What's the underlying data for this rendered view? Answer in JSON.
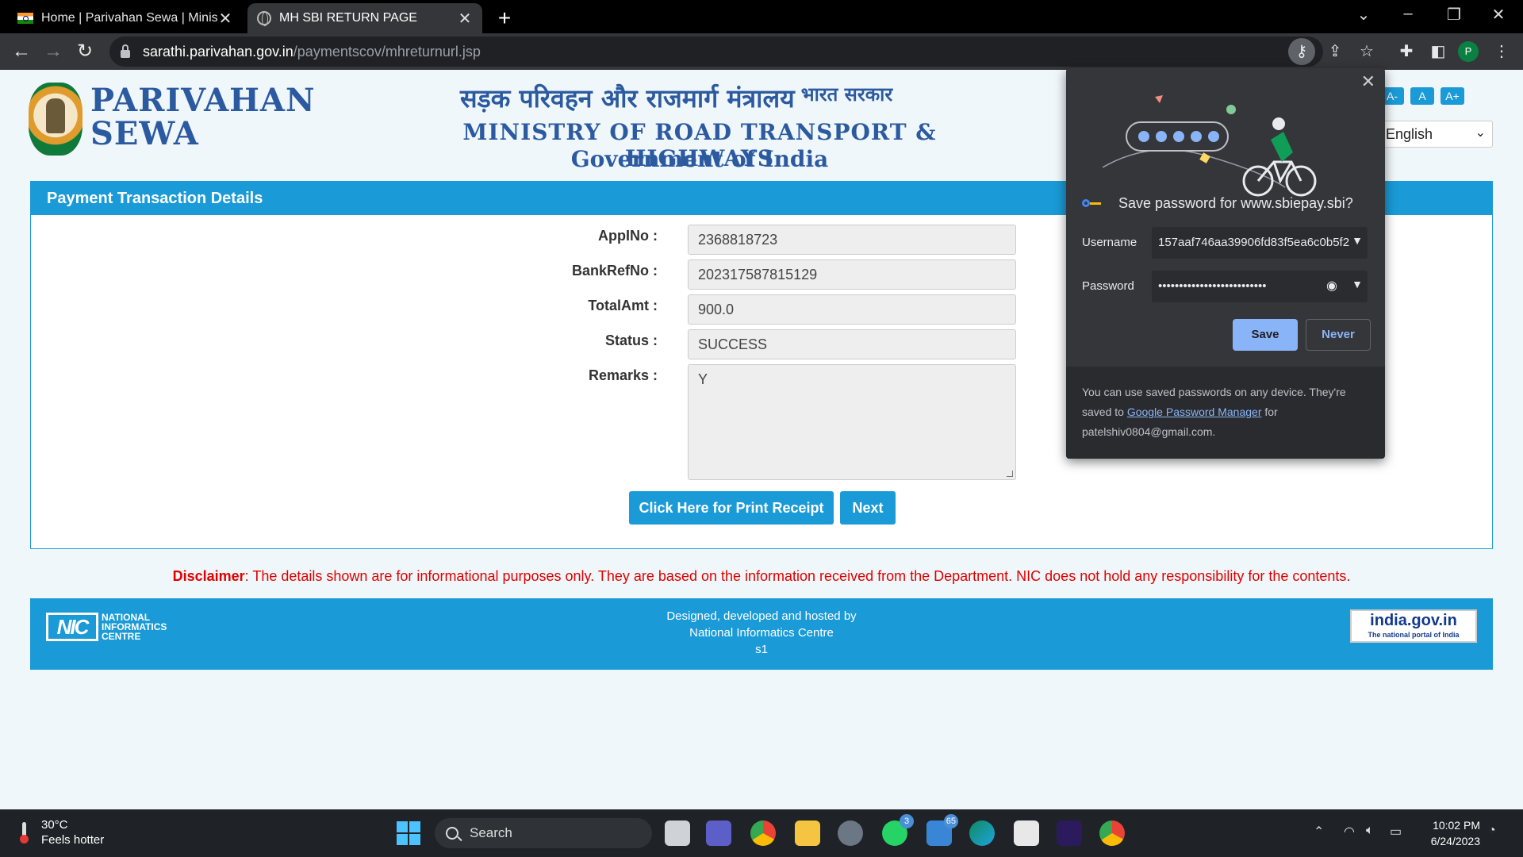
{
  "browser": {
    "tabs": [
      {
        "title": "Home | Parivahan Sewa | Ministry",
        "icon": "india-flag-icon"
      },
      {
        "title": "MH SBI RETURN PAGE",
        "icon": "globe-icon"
      }
    ],
    "url_host": "sarathi.parivahan.gov.in",
    "url_path": "/paymentscov/mhreturnurl.jsp",
    "profile_initial": "P"
  },
  "header": {
    "brand_line1": "PARIVAHAN",
    "brand_line2": "SEWA",
    "hindi_title": "सड़क परिवहन और राजमार्ग मंत्रालय",
    "hindi_sub": "भारत सरकार",
    "ministry": "MINISTRY OF ROAD TRANSPORT & HIGHWAYS",
    "gov": "Government of India",
    "font_buttons": [
      "A-",
      "A",
      "A+"
    ],
    "language": "English"
  },
  "panel": {
    "title": "Payment Transaction Details",
    "fields": [
      {
        "label": "AppINo :",
        "value": "2368818723"
      },
      {
        "label": "BankRefNo :",
        "value": "202317587815129"
      },
      {
        "label": "TotalAmt :",
        "value": "900.0"
      },
      {
        "label": "Status :",
        "value": "SUCCESS"
      },
      {
        "label": "Remarks :",
        "value": "Y"
      }
    ],
    "print_button": "Click Here for Print Receipt",
    "next_button": "Next"
  },
  "disclaimer": {
    "label": "Disclaimer",
    "text": ": The details shown are for informational purposes only. They are based on the information received from the Department. NIC does not hold any responsibility for the contents."
  },
  "footer": {
    "nic_mark": "NIC",
    "nic_name": [
      "NATIONAL",
      "INFORMATICS",
      "CENTRE"
    ],
    "line1": "Designed, developed and hosted by",
    "line2": "National Informatics Centre",
    "line3": "s1",
    "india_portal": "india.gov.in",
    "india_portal_sub": "The national portal of India"
  },
  "password_bubble": {
    "title": "Save password for www.sbiepay.sbi?",
    "username_label": "Username",
    "username_value": "157aaf746aa39906fd83f5ea6c0b5f2",
    "password_label": "Password",
    "password_value": "••••••••••••••••••••••••••",
    "save": "Save",
    "never": "Never",
    "footer_pre": "You can use saved passwords on any device. They're saved to ",
    "footer_link": "Google Password Manager",
    "footer_post": " for patelshiv0804@gmail.com."
  },
  "taskbar": {
    "temperature": "30°C",
    "weather_text": "Feels hotter",
    "search_placeholder": "Search",
    "whatsapp_badge": "3",
    "mail_badge": "65",
    "time": "10:02 PM",
    "date": "6/24/2023"
  },
  "colors": {
    "accent": "#1a9ad6",
    "brand_blue": "#2c5aa0",
    "disclaimer_red": "#e00000",
    "chrome_dark": "#35363a"
  }
}
